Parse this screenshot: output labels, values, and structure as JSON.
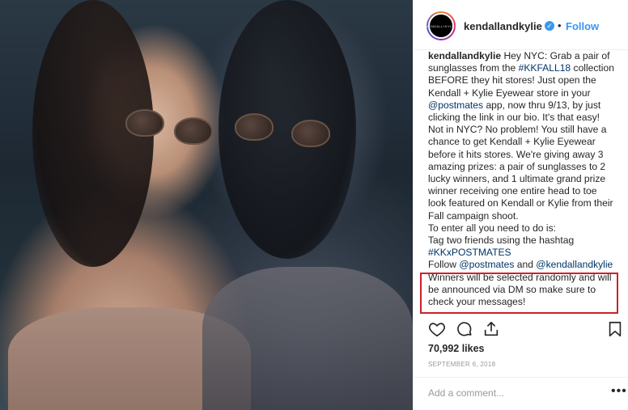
{
  "header": {
    "avatar_text": "KENDALL+KYLIE",
    "username": "kendallandkylie",
    "verified_symbol": "✓",
    "separator": "•",
    "follow_label": "Follow"
  },
  "caption": {
    "username": "kendallandkylie",
    "l1": "Hey NYC: Grab a pair of",
    "l2a": "sunglasses from the ",
    "l2_tag": "#KKFALL18",
    "l2b": " collection",
    "l3": "BEFORE they hit stores! Just open the",
    "l4": "Kendall + Kylie Eyewear store in your",
    "l5_mention": "@postmates",
    "l5b": " app, now thru 9/13, by just",
    "l6": "clicking the link in our bio. It's that easy!",
    "l7": "Not in NYC? No problem! You still have a",
    "l8": "chance to get Kendall + Kylie Eyewear",
    "l9": "before it hits stores. We're giving away 3",
    "l10": "amazing prizes: a pair of sunglasses to 2",
    "l11": "lucky winners, and 1 ultimate grand prize",
    "l12": "winner receiving one entire head to toe",
    "l13": "look featured on Kendall or Kylie from their",
    "l14": "Fall campaign shoot.",
    "l15": "To enter all you need to do is:",
    "l16": "Tag two friends using the hashtag",
    "l17_tag": "#KKxPOSTMATES",
    "l18a": "Follow ",
    "l18_m1": "@postmates",
    "l18b": " and ",
    "l18_m2": "@kendallandkylie",
    "l19": "Winners will be selected randomly and will",
    "l20": "be announced via DM so make sure to",
    "l21": "check your messages!"
  },
  "actions": {
    "like_icon": "heart-icon",
    "comment_icon": "comment-icon",
    "share_icon": "share-icon",
    "save_icon": "bookmark-icon"
  },
  "likes_text": "70,992 likes",
  "date_text": "SEPTEMBER 6, 2018",
  "comment": {
    "placeholder": "Add a comment...",
    "more_label": "•••"
  },
  "colors": {
    "link": "#003569",
    "follow": "#3897f0",
    "highlight": "#cc2229"
  }
}
